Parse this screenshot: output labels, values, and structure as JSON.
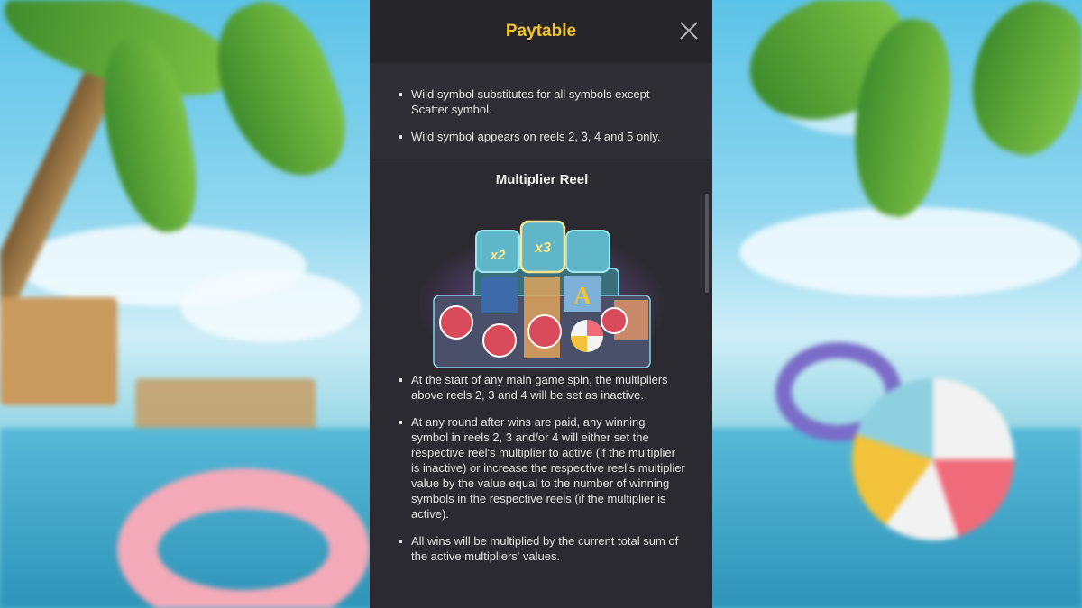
{
  "header": {
    "title": "Paytable"
  },
  "wild_rules": [
    "Wild symbol substitutes for all symbols except Scatter symbol.",
    "Wild symbol appears on reels 2, 3, 4 and 5 only."
  ],
  "multiplier_section": {
    "title": "Multiplier Reel",
    "multiplier_badges": [
      "x2",
      "x3"
    ],
    "rules": [
      "At the start of any main game spin, the multipliers above reels 2, 3 and 4 will be set as inactive.",
      "At any round after wins are paid, any winning symbol in reels 2, 3 and/or 4 will either set the respective reel's multiplier to active (if the multiplier is inactive) or increase the respective reel's multiplier value by the value equal to the number of winning symbols in the respective reels (if the multiplier is active).",
      "All wins will be multiplied by the current total sum of the active multipliers' values."
    ]
  },
  "colors": {
    "title": "#f2c230",
    "panel": "#2b2a30",
    "header": "#262529"
  }
}
